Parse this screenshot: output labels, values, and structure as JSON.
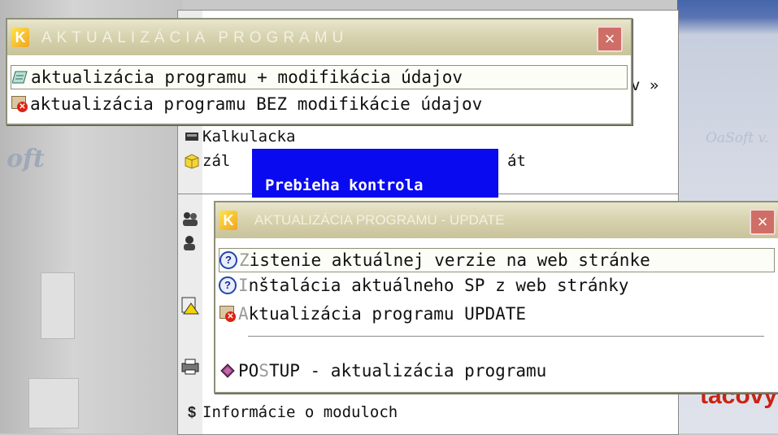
{
  "background": {
    "right_text": "tacovyc",
    "right_ghost": "OaSoft v.",
    "left_ghost": "oft"
  },
  "main_menu": {
    "items": [
      {
        "label": "Kalkulacka",
        "accel": "K",
        "icon": "calculator-icon"
      },
      {
        "label": "zál",
        "accel": "",
        "icon": "package-icon",
        "suffix": "át"
      },
      {
        "label": "Informácie o moduloch",
        "accel": "I",
        "icon": "dollar-icon"
      }
    ],
    "submenu_arrow": "v »",
    "progress_text": "Prebieha kontrola"
  },
  "popup_top": {
    "title": "AKTUALIZÁCIA PROGRAMU",
    "items": [
      {
        "label": "aktualizácia programu + modifikácia údajov",
        "icon": "update-modify-icon",
        "highlighted": true
      },
      {
        "label": "aktualizácia programu BEZ modifikácie údajov",
        "icon": "update-no-modify-icon",
        "highlighted": false
      }
    ]
  },
  "popup_bottom": {
    "title": "AKTUALIZÁCIA PROGRAMU - UPDATE",
    "items": [
      {
        "accel": "Z",
        "rest": "istenie aktuálnej verzie na web stránke",
        "icon": "help-icon",
        "highlighted": true
      },
      {
        "accel": "I",
        "rest": "nštalácia aktuálneho SP z web stránky",
        "icon": "help-icon",
        "highlighted": false
      },
      {
        "accel": "A",
        "rest": "ktualizácia programu  UPDATE",
        "icon": "update-no-modify-icon",
        "highlighted": false
      },
      {
        "pre": "PO",
        "accel": "S",
        "rest": "TUP - aktualizácia programu",
        "icon": "book-icon",
        "highlighted": false
      }
    ]
  },
  "colors": {
    "progress_banner": "#0a0af0",
    "titlebar": "#d6d2ae",
    "close_button": "#cf6e66",
    "accent_red": "#cc2211"
  }
}
